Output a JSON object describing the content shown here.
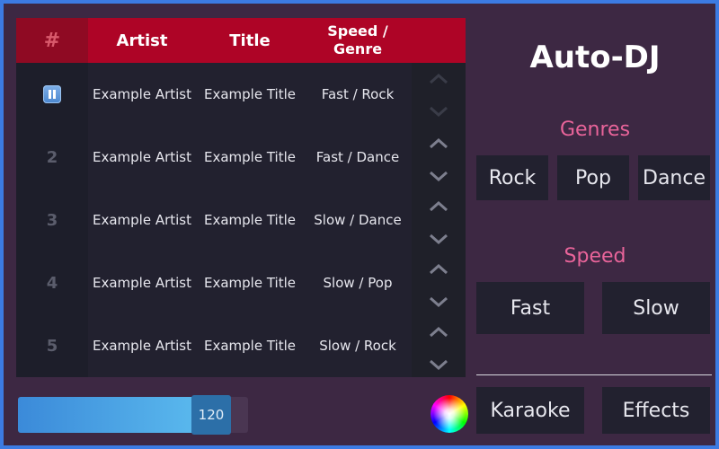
{
  "playlist": {
    "headers": {
      "num": "#",
      "artist": "Artist",
      "title": "Title",
      "genre": "Speed / Genre"
    },
    "rows": [
      {
        "num": "",
        "playing": true,
        "artist": "Example Artist",
        "title": "Example Title",
        "genre": "Fast / Rock"
      },
      {
        "num": "2",
        "artist": "Example Artist",
        "title": "Example Title",
        "genre": "Fast / Dance"
      },
      {
        "num": "3",
        "artist": "Example Artist",
        "title": "Example Title",
        "genre": "Slow / Dance"
      },
      {
        "num": "4",
        "artist": "Example Artist",
        "title": "Example Title",
        "genre": "Slow / Pop"
      },
      {
        "num": "5",
        "artist": "Example Artist",
        "title": "Example Title",
        "genre": "Slow / Rock"
      }
    ]
  },
  "panel": {
    "title": "Auto-DJ",
    "genres_label": "Genres",
    "genres": [
      "Rock",
      "Pop",
      "Dance"
    ],
    "speed_label": "Speed",
    "speeds": [
      "Fast",
      "Slow"
    ],
    "actions": [
      "Karaoke",
      "Effects"
    ]
  },
  "tempo": {
    "value": "120",
    "fill_fraction": 0.84
  },
  "icons": {
    "playing": "pause-icon",
    "move_up": "chevron-up-icon",
    "move_down": "chevron-down-icon",
    "color": "color-wheel-icon"
  },
  "colors": {
    "accent": "#ae0426",
    "label": "#e9649a",
    "slider": "#5cbcef",
    "frame": "#3c7be3"
  }
}
